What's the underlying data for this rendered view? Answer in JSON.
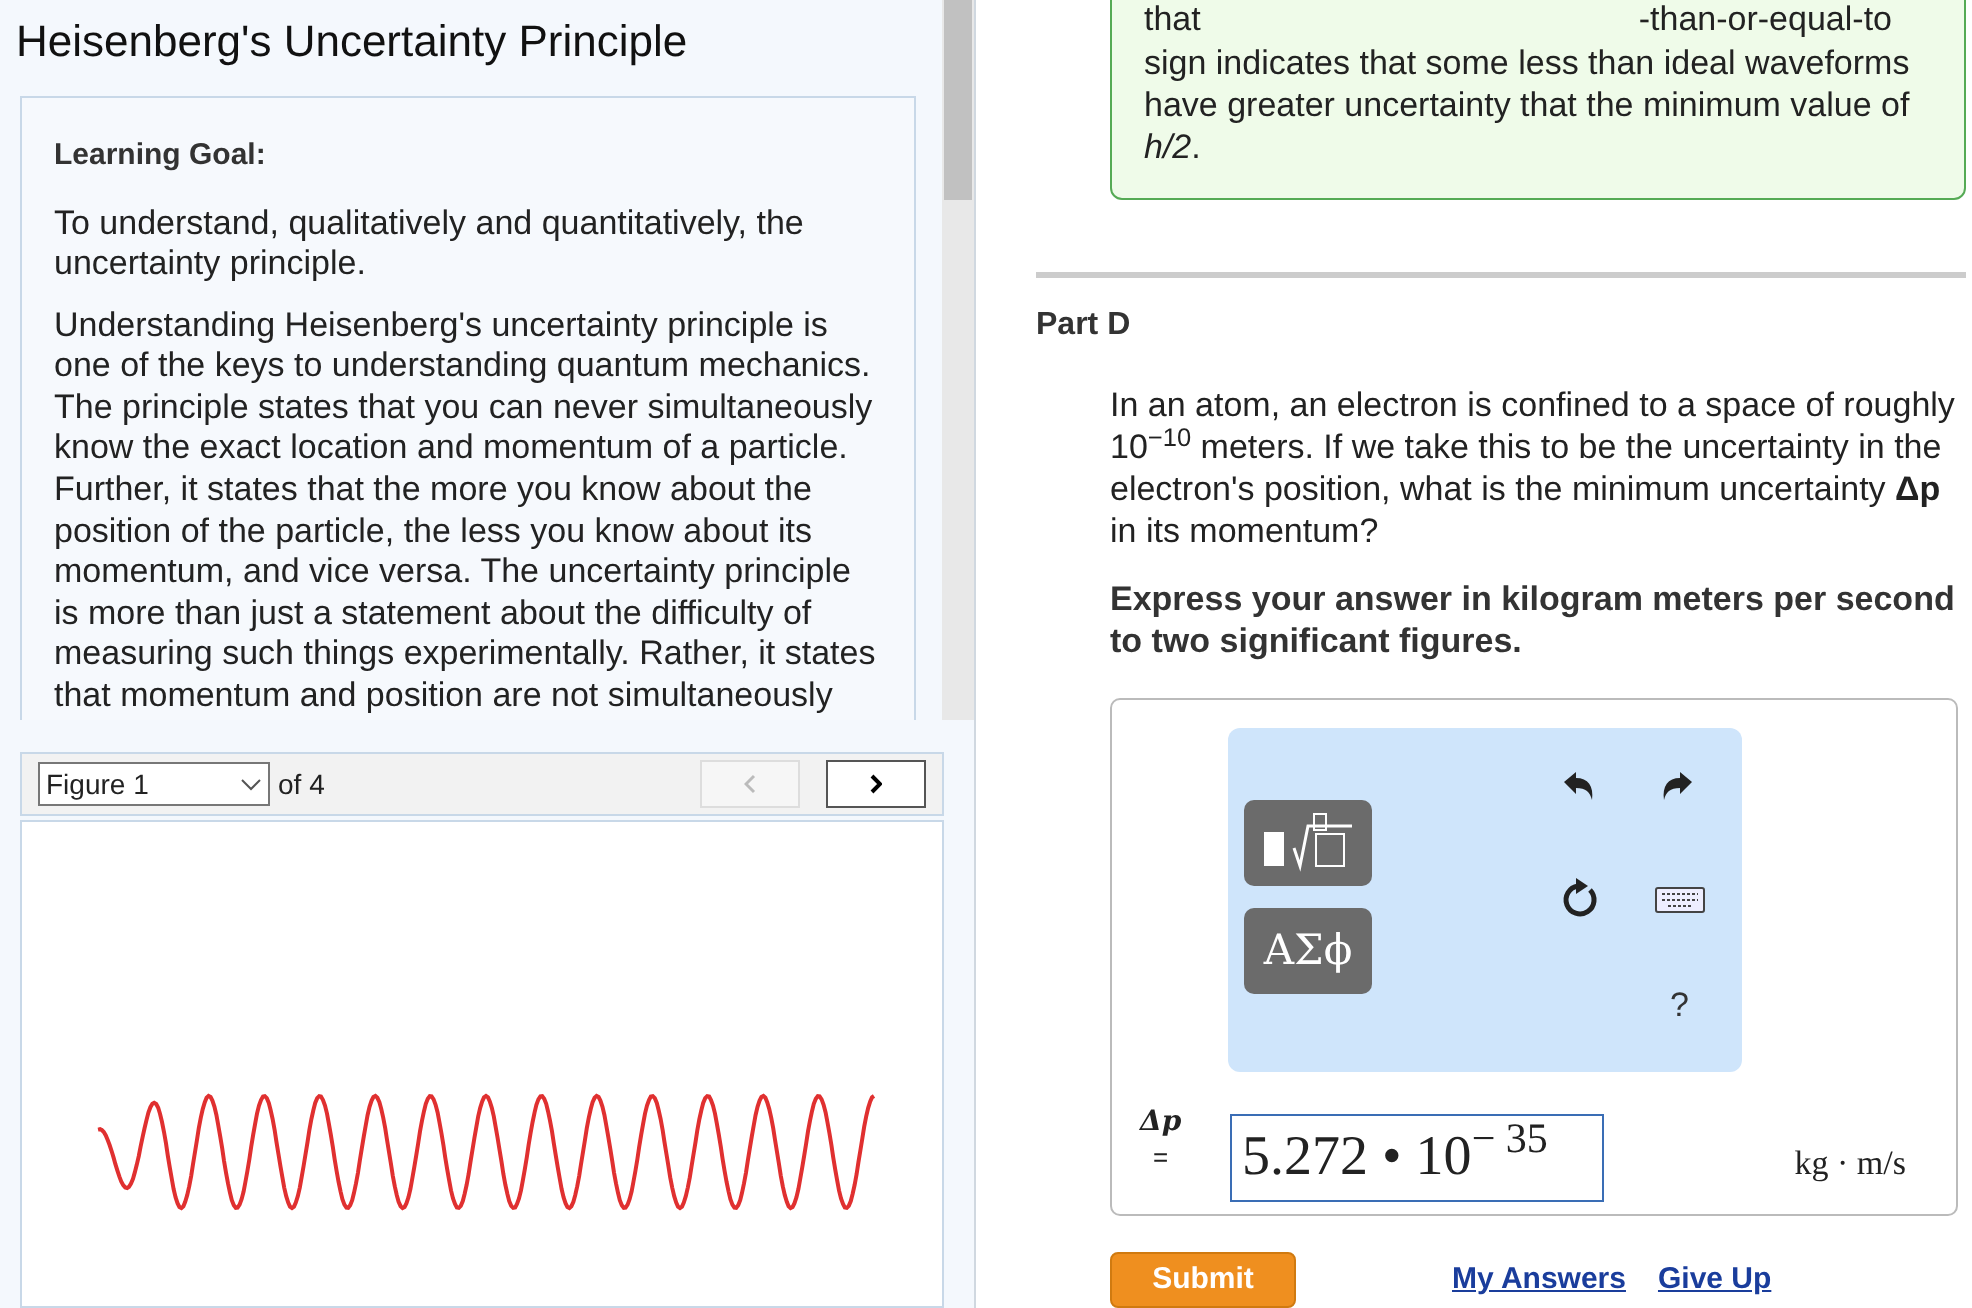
{
  "left_pane": {
    "title": "Heisenberg's Uncertainty Principle",
    "goal_heading": "Learning Goal:",
    "paragraphs": [
      "To understand, qualitatively and quantitatively, the uncertainty principle.",
      "Understanding Heisenberg's uncertainty principle is one of the keys to understanding quantum mechanics. The principle states that you can never simultaneously know the exact location and momentum of a particle. Further, it states that the more you know about the position of the particle, the less you know about its momentum, and vice versa. The uncertainty principle is more than just a statement about the difficulty of measuring such things experimentally. Rather, it states that momentum and position are not simultaneously"
    ],
    "figure_select": "Figure 1",
    "figure_count": "of 4",
    "prev_disabled": true,
    "next_disabled": false
  },
  "right_pane": {
    "feedback": {
      "top_left": "that",
      "top_right": "-than-or-equal-to",
      "body": "sign indicates that some less than ideal waveforms have greater uncertainty that the minimum value of *h/2*."
    },
    "part": {
      "title": "Part D",
      "question": "In an atom, an electron is confined to a space of roughly 10$^{−10}$ meters. If we take this to be the uncertainty in the electron's position, what is the minimum uncertainty **Δp** in its momentum?",
      "instruction": "Express your answer in kilogram meters per second to two significant figures.",
      "toolbar": {
        "symbols_button": "ΑΣϕ",
        "help": "?"
      },
      "answer_label": "Δp",
      "equals": "=",
      "answer_value": "5.272 • 10$^{− 35}$",
      "units": "kg · m/s",
      "submit": "Submit",
      "links": [
        "My Answers",
        "Give Up"
      ]
    }
  }
}
